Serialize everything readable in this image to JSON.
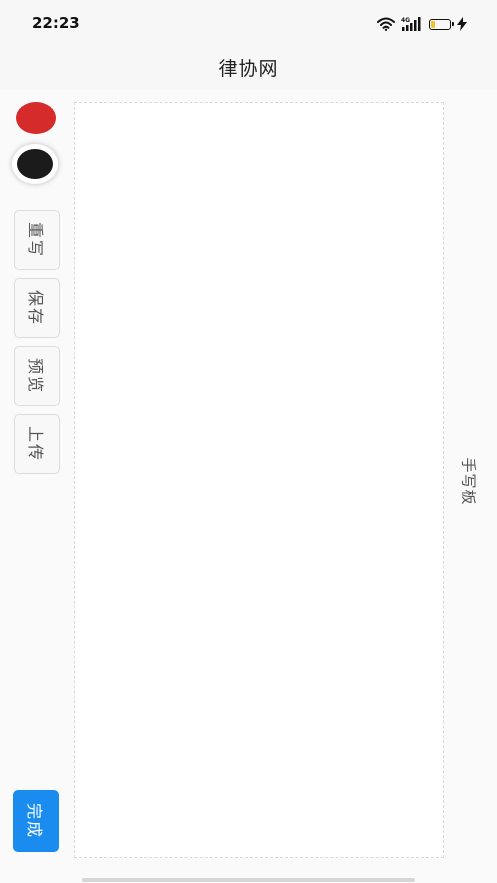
{
  "status_bar": {
    "time": "22:23",
    "network": "4G"
  },
  "header": {
    "title": "律协网"
  },
  "palette": {
    "red": "#d62b2b",
    "black": "#1b1b1b"
  },
  "toolbar": {
    "rewrite_label": "重写",
    "save_label": "保存",
    "preview_label": "预览",
    "upload_label": "上传",
    "done_label": "完成"
  },
  "canvas": {
    "side_label": "手写板"
  },
  "colors": {
    "accent": "#1a8cf0",
    "battery": "#f0c431"
  }
}
